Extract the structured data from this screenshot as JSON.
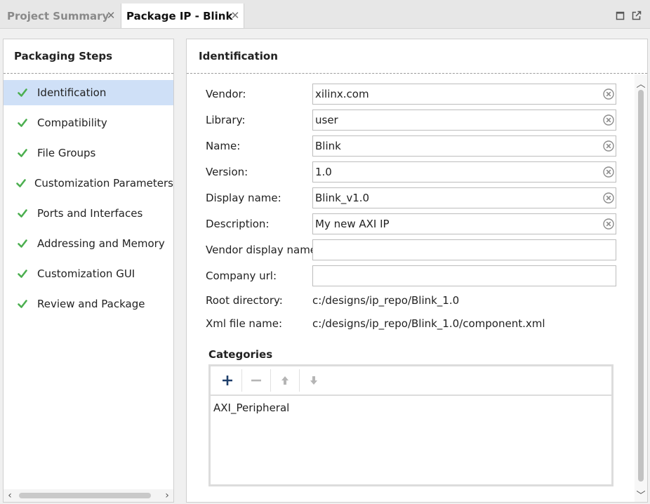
{
  "tabs": [
    {
      "label": "Project Summary",
      "active": false
    },
    {
      "label": "Package IP - Blink",
      "active": true
    }
  ],
  "left_panel": {
    "title": "Packaging Steps",
    "steps": [
      {
        "label": "Identification",
        "selected": true
      },
      {
        "label": "Compatibility"
      },
      {
        "label": "File Groups"
      },
      {
        "label": "Customization Parameters"
      },
      {
        "label": "Ports and Interfaces"
      },
      {
        "label": "Addressing and Memory"
      },
      {
        "label": "Customization GUI"
      },
      {
        "label": "Review and Package"
      }
    ]
  },
  "identification": {
    "title": "Identification",
    "fields": {
      "vendor": {
        "label": "Vendor:",
        "value": "xilinx.com"
      },
      "library": {
        "label": "Library:",
        "value": "user"
      },
      "name": {
        "label": "Name:",
        "value": "Blink"
      },
      "version": {
        "label": "Version:",
        "value": "1.0"
      },
      "display_name": {
        "label": "Display name:",
        "value": "Blink_v1.0"
      },
      "description": {
        "label": "Description:",
        "value": "My new AXI IP"
      },
      "vendor_display_name": {
        "label": "Vendor display name:",
        "value": ""
      },
      "company_url": {
        "label": "Company url:",
        "value": ""
      }
    },
    "root_directory": {
      "label": "Root directory:",
      "value": "c:/designs/ip_repo/Blink_1.0"
    },
    "xml_file_name": {
      "label": "Xml file name:",
      "value": "c:/designs/ip_repo/Blink_1.0/component.xml"
    }
  },
  "categories": {
    "title": "Categories",
    "items": [
      "AXI_Peripheral"
    ]
  },
  "colors": {
    "check": "#4caf50",
    "selected_row": "#cfe0f7",
    "add_icon": "#1f3f6b",
    "disabled_icon": "#b5b5b5"
  }
}
